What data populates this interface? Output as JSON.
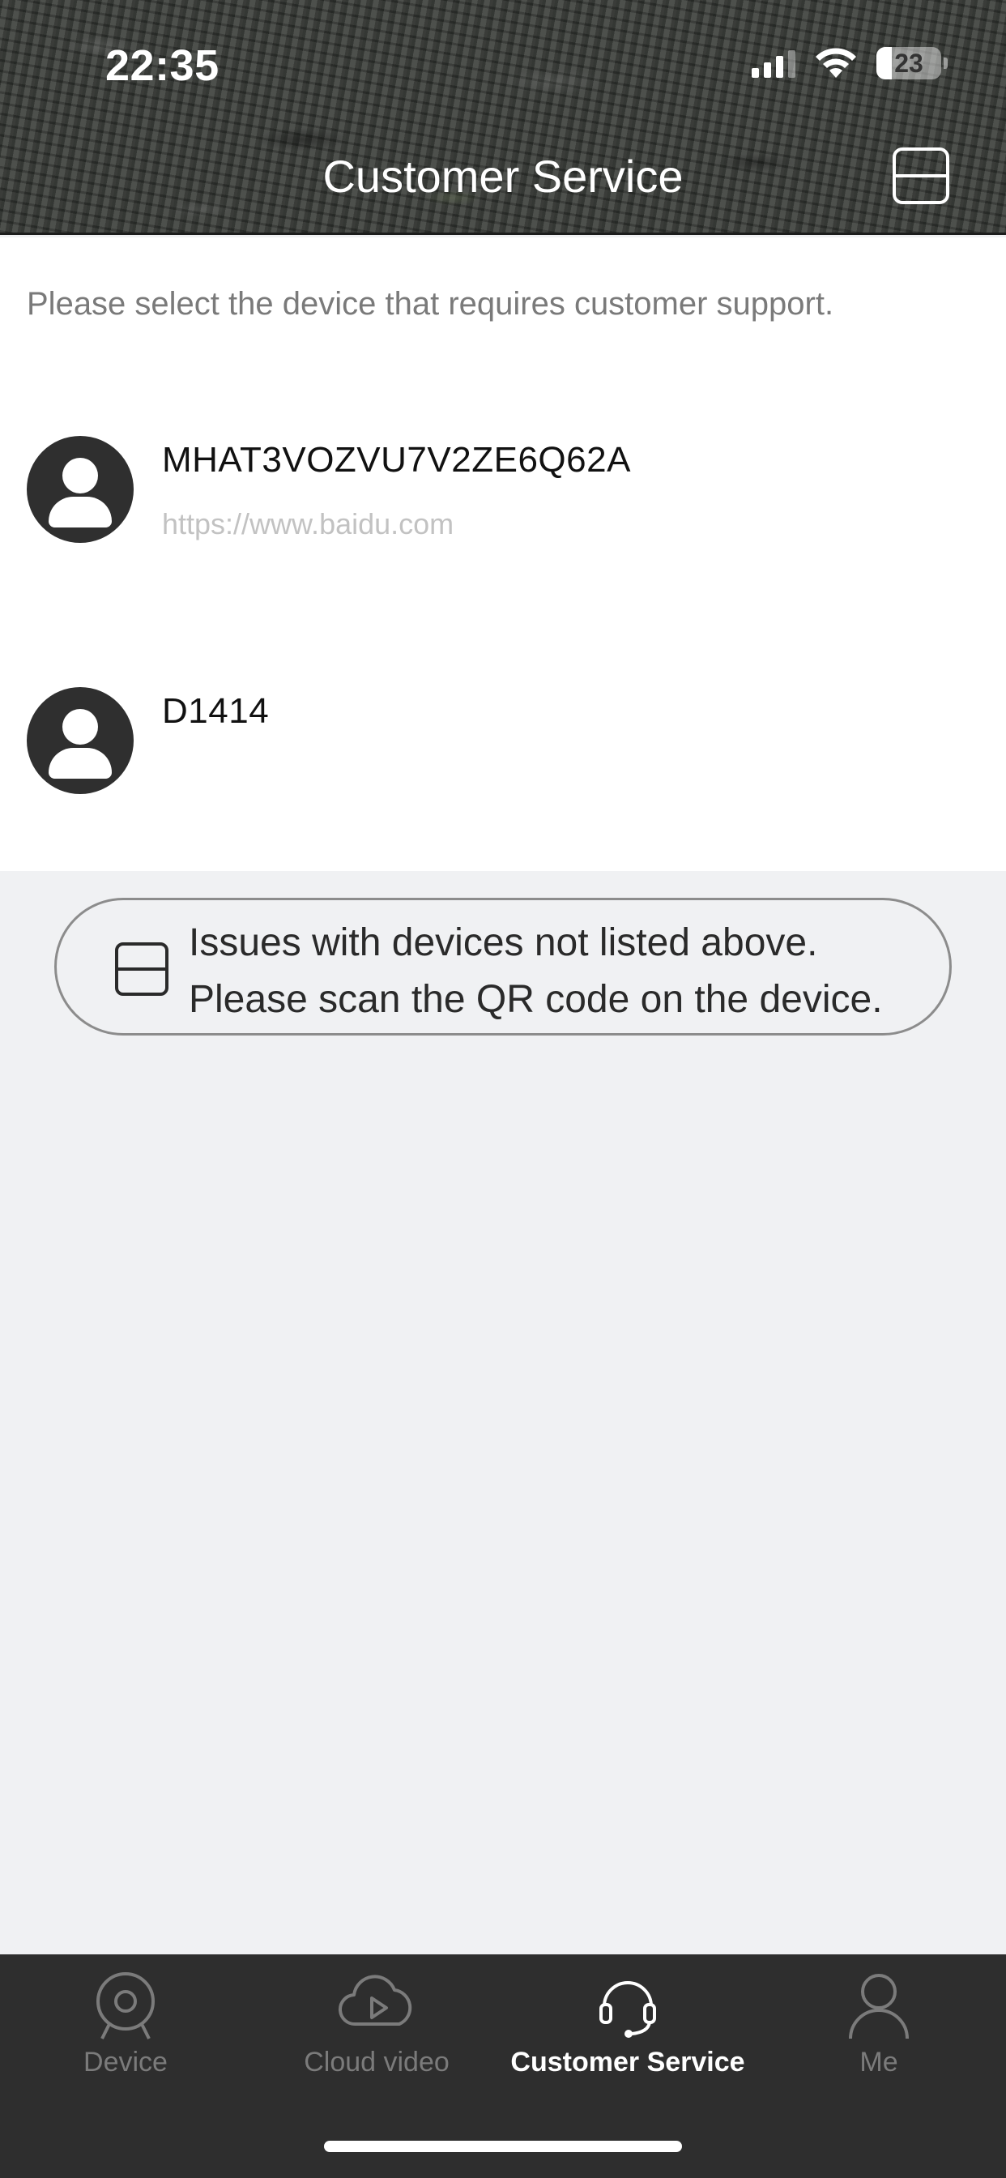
{
  "status_bar": {
    "time": "22:35",
    "battery": "23"
  },
  "header": {
    "title": "Customer Service",
    "scan_icon": "scan-qr-icon"
  },
  "content": {
    "instruction": "Please select the device that requires customer support.",
    "devices": [
      {
        "name": "MHAT3VOZVU7V2ZE6Q62A",
        "url": "https://www.baidu.com",
        "icon": "user-avatar-icon"
      },
      {
        "name": "D1414",
        "url": "",
        "icon": "user-avatar-icon"
      }
    ]
  },
  "scan_prompt": {
    "line1": "Issues with devices not listed above.",
    "line2": "Please scan the QR code on the device.",
    "icon": "scan-qr-icon"
  },
  "tabbar": {
    "tabs": [
      {
        "label": "Device",
        "icon": "camera-icon",
        "active": false
      },
      {
        "label": "Cloud video",
        "icon": "cloud-play-icon",
        "active": false
      },
      {
        "label": "Customer Service",
        "icon": "headset-icon",
        "active": true
      },
      {
        "label": "Me",
        "icon": "person-icon",
        "active": false
      }
    ]
  },
  "colors": {
    "header_bg": "#3c3f3b",
    "content_bg": "#ffffff",
    "page_bg": "#f0f1f3",
    "tabbar_bg": "#2e2e2e",
    "tab_inactive": "#7b7b7b",
    "tab_active": "#ffffff"
  }
}
